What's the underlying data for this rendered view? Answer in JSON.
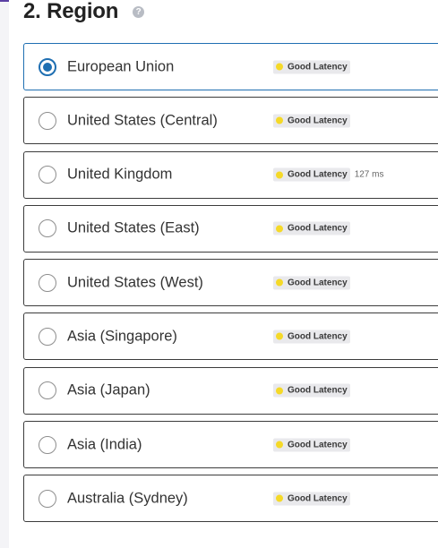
{
  "section": {
    "title": "2. Region",
    "help_icon": "question-mark-icon"
  },
  "colors": {
    "selected_accent": "#1f6fb2",
    "latency_good": "#f5d928",
    "top_accent": "#5b3fa3"
  },
  "regions": [
    {
      "name": "European Union",
      "selected": true,
      "latency_label": "Good Latency",
      "latency_ms": ""
    },
    {
      "name": "United States (Central)",
      "selected": false,
      "latency_label": "Good Latency",
      "latency_ms": ""
    },
    {
      "name": "United Kingdom",
      "selected": false,
      "latency_label": "Good Latency",
      "latency_ms": "127 ms"
    },
    {
      "name": "United States (East)",
      "selected": false,
      "latency_label": "Good Latency",
      "latency_ms": ""
    },
    {
      "name": "United States (West)",
      "selected": false,
      "latency_label": "Good Latency",
      "latency_ms": ""
    },
    {
      "name": "Asia (Singapore)",
      "selected": false,
      "latency_label": "Good Latency",
      "latency_ms": ""
    },
    {
      "name": "Asia (Japan)",
      "selected": false,
      "latency_label": "Good Latency",
      "latency_ms": ""
    },
    {
      "name": "Asia (India)",
      "selected": false,
      "latency_label": "Good Latency",
      "latency_ms": ""
    },
    {
      "name": "Australia (Sydney)",
      "selected": false,
      "latency_label": "Good Latency",
      "latency_ms": ""
    }
  ]
}
